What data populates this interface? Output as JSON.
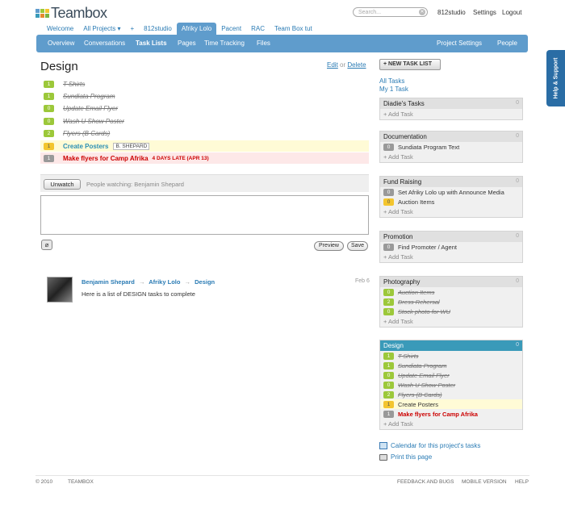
{
  "colors": {
    "navbar": "#5f9ccc",
    "link": "#2a7bb4",
    "badge_green": "#9cc83a",
    "badge_gray": "#999999",
    "badge_yellow": "#f3c52e",
    "late_red": "#cc0000",
    "highlight_yellow": "#fffbd6",
    "highlight_red": "#fde8e8",
    "panel_blue": "#3a9ab9",
    "help_tab": "#2a6da5"
  },
  "header": {
    "logo": "Teambox",
    "search_placeholder": "Search...",
    "user": "812studio",
    "settings": "Settings",
    "logout": "Logout"
  },
  "project_tabs": [
    "Welcome",
    "All Projects ▾",
    "+",
    "812studio",
    "Afriky Lolo",
    "Pacent",
    "RAC",
    "Team Box tut"
  ],
  "nav": {
    "left": [
      "Overview",
      "Conversations",
      "Task Lists",
      "Pages",
      "Time Tracking",
      "Files"
    ],
    "right": [
      "Project Settings",
      "People"
    ]
  },
  "main": {
    "title": "Design",
    "edit": "Edit",
    "or": "or",
    "delete": "Delete",
    "tasks": [
      {
        "count": "1",
        "name": "T-Shirts",
        "done": true
      },
      {
        "count": "1",
        "name": "Sundiata Program",
        "done": true
      },
      {
        "count": "0",
        "name": "Update Email Flyer",
        "done": true
      },
      {
        "count": "0",
        "name": "Wash U Show Poster",
        "done": true
      },
      {
        "count": "2",
        "name": "Flyers (B Cards)",
        "done": true
      },
      {
        "count": "1",
        "name": "Create Posters",
        "assignee": "B. SHEPARD"
      },
      {
        "count": "1",
        "name": "Make flyers for Camp Afrika",
        "late": "4 DAYS LATE (APR 13)"
      }
    ],
    "unwatch": "Unwatch",
    "watching": "People watching: Benjamin Shepard",
    "attach_icon": "paperclip-icon",
    "preview": "Preview",
    "save": "Save",
    "comment": {
      "author": "Benjamin Shepard",
      "arrow": "→",
      "project": "Afriky Lolo",
      "list": "Design",
      "date": "Feb 6",
      "body": "Here is a list of DESIGN tasks to complete"
    }
  },
  "sidebar": {
    "new_task_list": "NEW TASK LIST",
    "all_tasks": "All Tasks",
    "my_tasks": "My 1 Task",
    "add_task": "+ Add Task",
    "panels": [
      {
        "title": "Diadie's Tasks",
        "count": "0",
        "items": []
      },
      {
        "title": "Documentation",
        "count": "0",
        "items": [
          {
            "count": "0",
            "name": "Sundiata Program Text"
          }
        ]
      },
      {
        "title": "Fund Raising",
        "count": "0",
        "items": [
          {
            "count": "0",
            "name": "Set Afriky Lolo up with Announce Media"
          },
          {
            "count": "0",
            "name": "Auction Items",
            "badge": "yellow"
          }
        ]
      },
      {
        "title": "Promotion",
        "count": "0",
        "items": [
          {
            "count": "0",
            "name": "Find Promoter / Agent"
          }
        ]
      },
      {
        "title": "Photography",
        "count": "0",
        "items": [
          {
            "count": "0",
            "name": "Auction Items",
            "done": true
          },
          {
            "count": "2",
            "name": "Dress Rehersal",
            "done": true
          },
          {
            "count": "0",
            "name": "Stock photo for WU",
            "done": true
          }
        ]
      },
      {
        "title": "Design",
        "count": "0",
        "items": [
          {
            "count": "1",
            "name": "T-Shirts",
            "done": true
          },
          {
            "count": "1",
            "name": "Sundiata Program",
            "done": true
          },
          {
            "count": "0",
            "name": "Update Email Flyer",
            "done": true
          },
          {
            "count": "0",
            "name": "Wash U Show Poster",
            "done": true
          },
          {
            "count": "2",
            "name": "Flyers (B Cards)",
            "done": true
          },
          {
            "count": "1",
            "name": "Create Posters",
            "badge": "yellow",
            "highlight": true
          },
          {
            "count": "1",
            "name": "Make flyers for Camp Afrika",
            "late": true
          }
        ]
      }
    ],
    "calendar": "Calendar for this project's tasks",
    "print": "Print this page"
  },
  "footer": {
    "copyright": "© 2010",
    "brand": "TEAMBOX",
    "feedback": "FEEDBACK AND BUGS",
    "mobile": "MOBILE VERSION",
    "help": "HELP"
  },
  "help_tab": "Help & Support"
}
